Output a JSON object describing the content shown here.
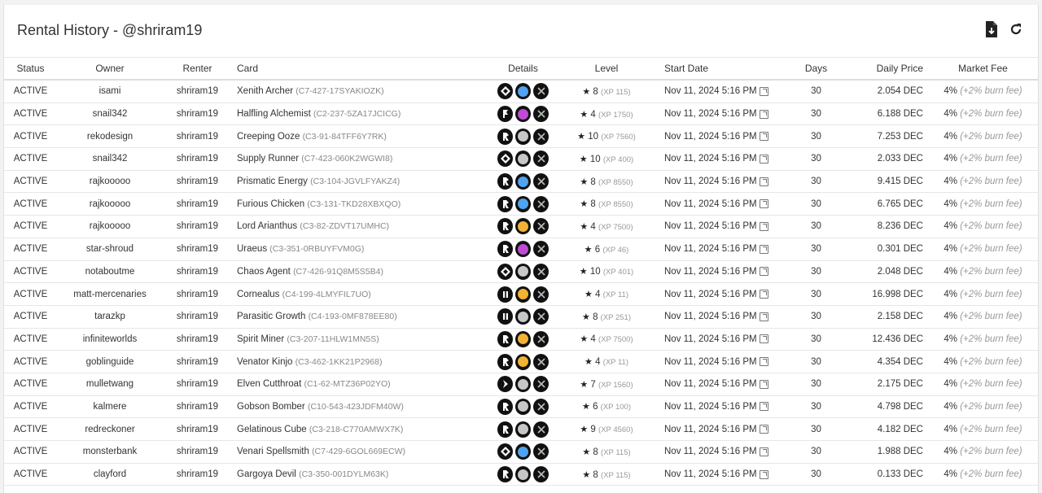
{
  "page": {
    "title": "Rental History - @shriram19"
  },
  "icons": {
    "download": "download-file-icon",
    "refresh": "refresh-icon"
  },
  "columns": {
    "status": "Status",
    "owner": "Owner",
    "renter": "Renter",
    "card": "Card",
    "details": "Details",
    "level": "Level",
    "start_date": "Start Date",
    "days": "Days",
    "daily_price": "Daily Price",
    "market_fee": "Market Fee"
  },
  "colors": {
    "red": "#3b8fe0",
    "blue": "#4fa3f0",
    "purple": "#c04ad6",
    "gray": "#c7c7c7",
    "gold": "#f2b233"
  },
  "rows": [
    {
      "status": "ACTIVE",
      "owner": "isami",
      "renter": "shriram19",
      "card": "Xenith Archer",
      "uid": "(C7-427-17SYAKIOZK)",
      "edition": "diamond-icon",
      "element": "blue",
      "level": "8",
      "xp": "(XP 115)",
      "start": "Nov 11, 2024 5:16 PM",
      "days": "30",
      "price": "2.054 DEC",
      "fee": "4%",
      "fee_note": "(+2% burn fee)"
    },
    {
      "status": "ACTIVE",
      "owner": "snail342",
      "renter": "shriram19",
      "card": "Halfling Alchemist",
      "uid": "(C2-237-5ZA17JCICG)",
      "edition": "flag-icon",
      "element": "purple",
      "level": "4",
      "xp": "(XP 1750)",
      "start": "Nov 11, 2024 5:16 PM",
      "days": "30",
      "price": "6.188 DEC",
      "fee": "4%",
      "fee_note": "(+2% burn fee)"
    },
    {
      "status": "ACTIVE",
      "owner": "rekodesign",
      "renter": "shriram19",
      "card": "Creeping Ooze",
      "uid": "(C3-91-84TFF6Y7RK)",
      "edition": "arrow-icon",
      "element": "gray",
      "level": "10",
      "xp": "(XP 7560)",
      "start": "Nov 11, 2024 5:16 PM",
      "days": "30",
      "price": "7.253 DEC",
      "fee": "4%",
      "fee_note": "(+2% burn fee)"
    },
    {
      "status": "ACTIVE",
      "owner": "snail342",
      "renter": "shriram19",
      "card": "Supply Runner",
      "uid": "(C7-423-060K2WGWI8)",
      "edition": "diamond-icon",
      "element": "gray",
      "level": "10",
      "xp": "(XP 400)",
      "start": "Nov 11, 2024 5:16 PM",
      "days": "30",
      "price": "2.033 DEC",
      "fee": "4%",
      "fee_note": "(+2% burn fee)"
    },
    {
      "status": "ACTIVE",
      "owner": "rajkooooo",
      "renter": "shriram19",
      "card": "Prismatic Energy",
      "uid": "(C3-104-JGVLFYAKZ4)",
      "edition": "arrow-icon",
      "element": "blue",
      "level": "8",
      "xp": "(XP 8550)",
      "start": "Nov 11, 2024 5:16 PM",
      "days": "30",
      "price": "9.415 DEC",
      "fee": "4%",
      "fee_note": "(+2% burn fee)"
    },
    {
      "status": "ACTIVE",
      "owner": "rajkooooo",
      "renter": "shriram19",
      "card": "Furious Chicken",
      "uid": "(C3-131-TKD28XBXQO)",
      "edition": "arrow-icon",
      "element": "blue",
      "level": "8",
      "xp": "(XP 8550)",
      "start": "Nov 11, 2024 5:16 PM",
      "days": "30",
      "price": "6.765 DEC",
      "fee": "4%",
      "fee_note": "(+2% burn fee)"
    },
    {
      "status": "ACTIVE",
      "owner": "rajkooooo",
      "renter": "shriram19",
      "card": "Lord Arianthus",
      "uid": "(C3-82-ZDVT17UMHC)",
      "edition": "arrow-icon",
      "element": "gold",
      "level": "4",
      "xp": "(XP 7500)",
      "start": "Nov 11, 2024 5:16 PM",
      "days": "30",
      "price": "8.236 DEC",
      "fee": "4%",
      "fee_note": "(+2% burn fee)"
    },
    {
      "status": "ACTIVE",
      "owner": "star-shroud",
      "renter": "shriram19",
      "card": "Uraeus",
      "uid": "(C3-351-0RBUYFVM0G)",
      "edition": "arrow-icon",
      "element": "purple",
      "level": "6",
      "xp": "(XP 46)",
      "start": "Nov 11, 2024 5:16 PM",
      "days": "30",
      "price": "0.301 DEC",
      "fee": "4%",
      "fee_note": "(+2% burn fee)"
    },
    {
      "status": "ACTIVE",
      "owner": "notaboutme",
      "renter": "shriram19",
      "card": "Chaos Agent",
      "uid": "(C7-426-91Q8M5S5B4)",
      "edition": "diamond-icon",
      "element": "gray",
      "level": "10",
      "xp": "(XP 401)",
      "start": "Nov 11, 2024 5:16 PM",
      "days": "30",
      "price": "2.048 DEC",
      "fee": "4%",
      "fee_note": "(+2% burn fee)"
    },
    {
      "status": "ACTIVE",
      "owner": "matt-mercenaries",
      "renter": "shriram19",
      "card": "Cornealus",
      "uid": "(C4-199-4LMYFIL7UO)",
      "edition": "pause-icon",
      "element": "gold",
      "level": "4",
      "xp": "(XP 11)",
      "start": "Nov 11, 2024 5:16 PM",
      "days": "30",
      "price": "16.998 DEC",
      "fee": "4%",
      "fee_note": "(+2% burn fee)"
    },
    {
      "status": "ACTIVE",
      "owner": "tarazkp",
      "renter": "shriram19",
      "card": "Parasitic Growth",
      "uid": "(C4-193-0MF878EE80)",
      "edition": "pause-icon",
      "element": "gray",
      "level": "8",
      "xp": "(XP 251)",
      "start": "Nov 11, 2024 5:16 PM",
      "days": "30",
      "price": "2.158 DEC",
      "fee": "4%",
      "fee_note": "(+2% burn fee)"
    },
    {
      "status": "ACTIVE",
      "owner": "infiniteworlds",
      "renter": "shriram19",
      "card": "Spirit Miner",
      "uid": "(C3-207-11HLW1MN5S)",
      "edition": "arrow-icon",
      "element": "gold",
      "level": "4",
      "xp": "(XP 7500)",
      "start": "Nov 11, 2024 5:16 PM",
      "days": "30",
      "price": "12.436 DEC",
      "fee": "4%",
      "fee_note": "(+2% burn fee)"
    },
    {
      "status": "ACTIVE",
      "owner": "goblinguide",
      "renter": "shriram19",
      "card": "Venator Kinjo",
      "uid": "(C3-462-1KK21P2968)",
      "edition": "arrow-icon",
      "element": "gold",
      "level": "4",
      "xp": "(XP 11)",
      "start": "Nov 11, 2024 5:16 PM",
      "days": "30",
      "price": "4.354 DEC",
      "fee": "4%",
      "fee_note": "(+2% burn fee)"
    },
    {
      "status": "ACTIVE",
      "owner": "mulletwang",
      "renter": "shriram19",
      "card": "Elven Cutthroat",
      "uid": "(C1-62-MTZ36P02YO)",
      "edition": "chevron-icon",
      "element": "gray",
      "level": "7",
      "xp": "(XP 1560)",
      "start": "Nov 11, 2024 5:16 PM",
      "days": "30",
      "price": "2.175 DEC",
      "fee": "4%",
      "fee_note": "(+2% burn fee)"
    },
    {
      "status": "ACTIVE",
      "owner": "kalmere",
      "renter": "shriram19",
      "card": "Gobson Bomber",
      "uid": "(C10-543-423JDFM40W)",
      "edition": "arrow-icon",
      "element": "gray",
      "level": "6",
      "xp": "(XP 100)",
      "start": "Nov 11, 2024 5:16 PM",
      "days": "30",
      "price": "4.798 DEC",
      "fee": "4%",
      "fee_note": "(+2% burn fee)"
    },
    {
      "status": "ACTIVE",
      "owner": "redreckoner",
      "renter": "shriram19",
      "card": "Gelatinous Cube",
      "uid": "(C3-218-C770AMWX7K)",
      "edition": "arrow-icon",
      "element": "gray",
      "level": "9",
      "xp": "(XP 4560)",
      "start": "Nov 11, 2024 5:16 PM",
      "days": "30",
      "price": "4.182 DEC",
      "fee": "4%",
      "fee_note": "(+2% burn fee)"
    },
    {
      "status": "ACTIVE",
      "owner": "monsterbank",
      "renter": "shriram19",
      "card": "Venari Spellsmith",
      "uid": "(C7-429-6GOL669ECW)",
      "edition": "diamond-icon",
      "element": "blue",
      "level": "8",
      "xp": "(XP 115)",
      "start": "Nov 11, 2024 5:16 PM",
      "days": "30",
      "price": "1.988 DEC",
      "fee": "4%",
      "fee_note": "(+2% burn fee)"
    },
    {
      "status": "ACTIVE",
      "owner": "clayford",
      "renter": "shriram19",
      "card": "Gargoya Devil",
      "uid": "(C3-350-001DYLM63K)",
      "edition": "arrow-icon",
      "element": "gray",
      "level": "8",
      "xp": "(XP 115)",
      "start": "Nov 11, 2024 5:16 PM",
      "days": "30",
      "price": "0.133 DEC",
      "fee": "4%",
      "fee_note": "(+2% burn fee)"
    }
  ]
}
